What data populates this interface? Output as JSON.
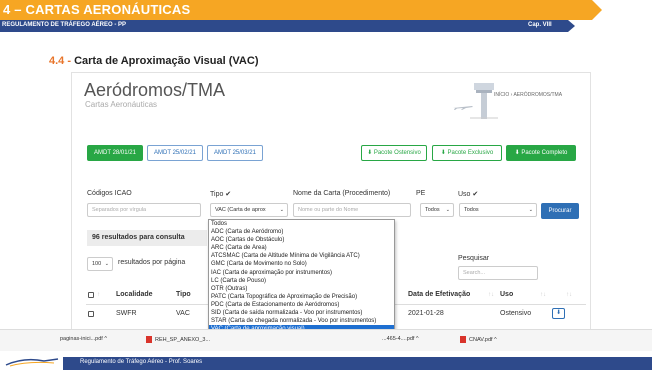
{
  "header": {
    "title": "4 – CARTAS AERONÁUTICAS",
    "subtitle": "REGULAMENTO DE TRÁFEGO AÉREO - PP",
    "chapter": "Cap. VIII",
    "accent": "#f6a623",
    "navy": "#2e4a8b"
  },
  "section": {
    "number": "4.4",
    "sep": " - ",
    "title": "Carta de Aproximação Visual (VAC)"
  },
  "banner": {
    "title": "Aeródromos/TMA",
    "subtitle": "Cartas Aeronáuticas",
    "breadcrumb": "INÍCIO  ›  AERÓDROMOS/TMA"
  },
  "amdt_buttons": [
    "AMDT 28/01/21",
    "AMDT 25/02/21",
    "AMDT 25/03/21"
  ],
  "packages": [
    "Pacote Ostensivo",
    "Pacote Exclusivo",
    "Pacote Completo"
  ],
  "filters": {
    "icao_label": "Códigos ICAO",
    "icao_placeholder": "Separados por vírgula",
    "tipo_label": "Tipo ✔",
    "tipo_value": "VAC (Carta de aprox",
    "nome_label": "Nome da Carta (Procedimento)",
    "nome_placeholder": "Nome ou parte do Nome",
    "pe_label": "PE",
    "pe_value": "Todos",
    "uso_label": "Uso ✔",
    "uso_value": "Todos",
    "search_button": "Procurar"
  },
  "results_text": "96 resultados para consulta",
  "per_page": {
    "value": "100",
    "label": "resultados por página"
  },
  "pesquisar": {
    "label": "Pesquisar",
    "placeholder": "Search..."
  },
  "dropdown_options": [
    "Todos",
    "ADC (Carta de Aeródromo)",
    "AOC (Cartas de Obstáculo)",
    "ARC (Carta de Área)",
    "ATCSMAC (Carta de Altitude Mínima de Vigilância ATC)",
    "GMC (Carta de Movimento no Solo)",
    "IAC (Carta de aproximação por instrumentos)",
    "LC (Carta de Pouso)",
    "OTR (Outras)",
    "PATC (Carta Topográfica de Aproximação de Precisão)",
    "PDC (Carta de Estacionamento de Aeródromos)",
    "SID (Carta de saída normalizada - Voo por instrumentos)",
    "STAR (Carta de chegada normalizada - Voo por instrumentos)",
    "VAC (Carta de aproximação visual)"
  ],
  "table": {
    "headers": [
      "Localidade",
      "Tipo",
      "Data de Efetivação",
      "Uso"
    ],
    "rows": [
      {
        "localidade": "SWFR",
        "tipo": "VAC",
        "data": "2021-01-28",
        "uso": "Ostensivo"
      }
    ]
  },
  "downloads": [
    "paginas-inici...pdf",
    "REH_SP_ANEXO_3...",
    "...465-4....pdf",
    "CNAV.pdf"
  ],
  "footer": {
    "text": "Regulamento de Tráfego Aéreo - Prof. Soares"
  }
}
